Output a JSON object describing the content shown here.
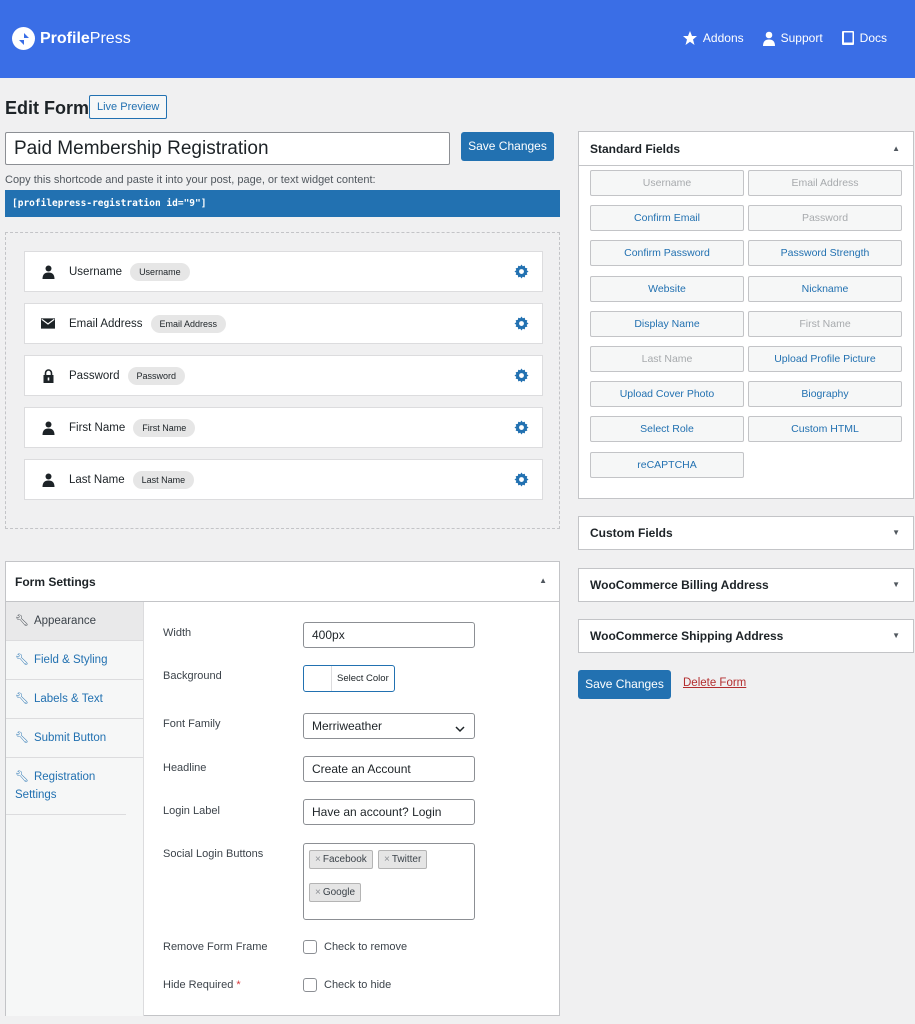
{
  "brand": {
    "name_bold": "Profile",
    "name_rest": "Press"
  },
  "topnav": {
    "addons": "Addons",
    "support": "Support",
    "docs": "Docs"
  },
  "page": {
    "title": "Edit Form",
    "live_preview": "Live Preview",
    "form_title_value": "Paid Membership Registration",
    "save_label": "Save Changes",
    "shortcode_hint": "Copy this shortcode and paste it into your post, page, or text widget content:",
    "shortcode": "[profilepress-registration id=\"9\"]"
  },
  "builder": {
    "fields": [
      {
        "icon": "user-icon",
        "label": "Username",
        "tag": "Username"
      },
      {
        "icon": "envelope-icon",
        "label": "Email Address",
        "tag": "Email Address"
      },
      {
        "icon": "lock-icon",
        "label": "Password",
        "tag": "Password"
      },
      {
        "icon": "user-icon",
        "label": "First Name",
        "tag": "First Name"
      },
      {
        "icon": "user-icon",
        "label": "Last Name",
        "tag": "Last Name"
      }
    ]
  },
  "settings": {
    "title": "Form Settings",
    "tabs": [
      {
        "label": "Appearance"
      },
      {
        "label": "Field & Styling"
      },
      {
        "label": "Labels & Text"
      },
      {
        "label": "Submit Button"
      },
      {
        "label": "Registration Settings"
      }
    ],
    "width_label": "Width",
    "width_value": "400px",
    "background_label": "Background",
    "select_color": "Select Color",
    "font_family_label": "Font Family",
    "font_family_value": "Merriweather",
    "headline_label": "Headline",
    "headline_value": "Create an Account",
    "login_label_label": "Login Label",
    "login_label_value": "Have an account? Login",
    "social_label": "Social Login Buttons",
    "social_chips": [
      "Facebook",
      "Twitter",
      "Google"
    ],
    "chip_remove": "×",
    "remove_frame_label": "Remove Form Frame",
    "remove_frame_check": "Check to remove",
    "hide_required_label": "Hide Required",
    "required_star": "*",
    "hide_required_check": "Check to hide"
  },
  "standard_fields": {
    "title": "Standard Fields",
    "items": [
      {
        "label": "Username",
        "enabled": false
      },
      {
        "label": "Email Address",
        "enabled": false
      },
      {
        "label": "Confirm Email",
        "enabled": true
      },
      {
        "label": "Password",
        "enabled": false
      },
      {
        "label": "Confirm Password",
        "enabled": true
      },
      {
        "label": "Password Strength",
        "enabled": true
      },
      {
        "label": "Website",
        "enabled": true
      },
      {
        "label": "Nickname",
        "enabled": true
      },
      {
        "label": "Display Name",
        "enabled": true
      },
      {
        "label": "First Name",
        "enabled": false
      },
      {
        "label": "Last Name",
        "enabled": false
      },
      {
        "label": "Upload Profile Picture",
        "enabled": true
      },
      {
        "label": "Upload Cover Photo",
        "enabled": true
      },
      {
        "label": "Biography",
        "enabled": true
      },
      {
        "label": "Select Role",
        "enabled": true
      },
      {
        "label": "Custom HTML",
        "enabled": true
      },
      {
        "label": "reCAPTCHA",
        "enabled": true
      }
    ]
  },
  "panels": {
    "custom_fields": "Custom Fields",
    "woo_billing": "WooCommerce Billing Address",
    "woo_shipping": "WooCommerce Shipping Address"
  },
  "actions": {
    "save_label": "Save Changes",
    "delete_label": "Delete Form"
  },
  "colors": {
    "header": "#3a6ee6",
    "primary": "#2271b1",
    "danger": "#b32d2e"
  }
}
